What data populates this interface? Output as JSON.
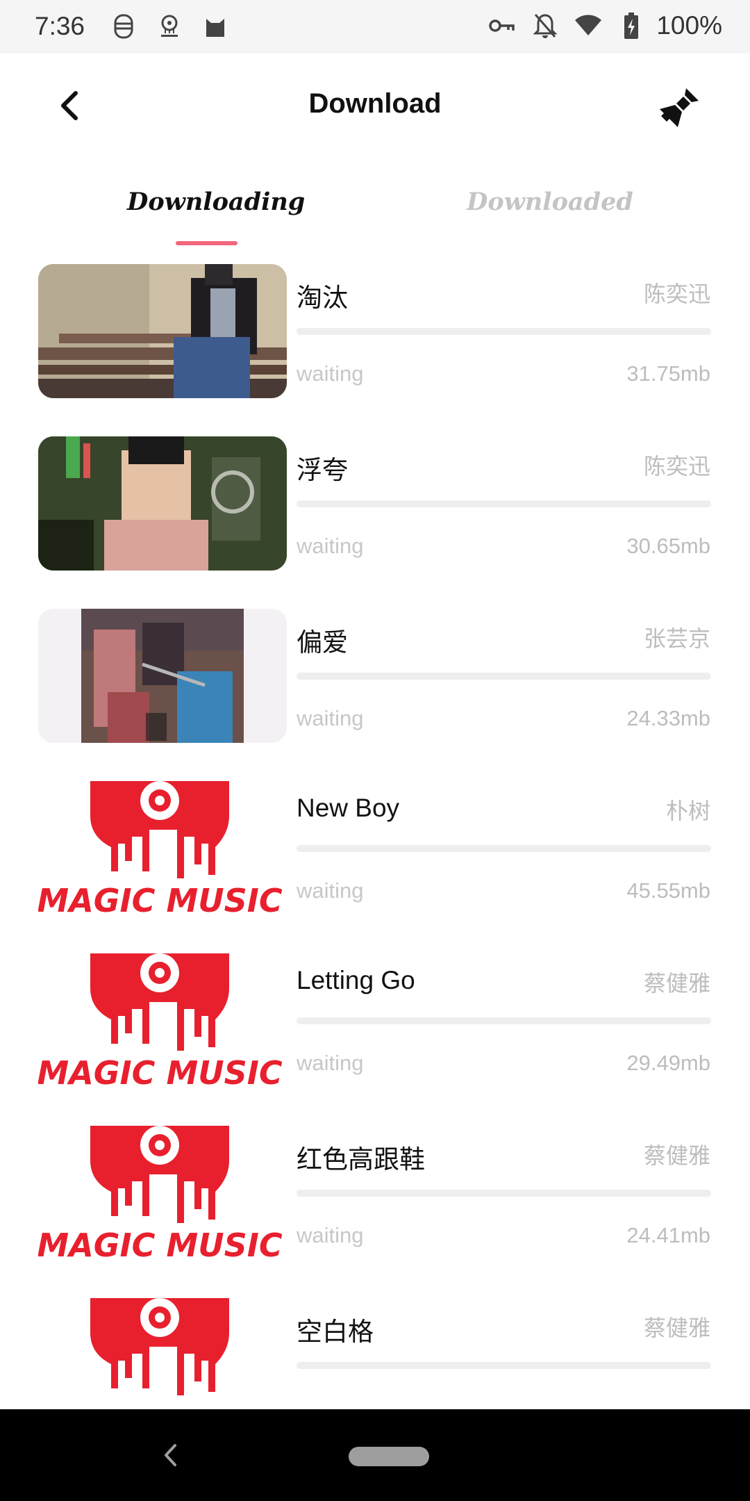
{
  "status_bar": {
    "time": "7:36",
    "battery": "100%",
    "left_icons": [
      "face-mask-icon",
      "magic-music-notification-icon",
      "cat-icon"
    ],
    "right_icons": [
      "vpn-key-icon",
      "notifications-off-icon",
      "wifi-icon",
      "battery-charging-icon"
    ]
  },
  "header": {
    "title": "Download",
    "back_icon": "arrow-back-icon",
    "clear_icon": "broom-clear-icon"
  },
  "tabs": [
    {
      "label": "Downloading",
      "active": true
    },
    {
      "label": "Downloaded",
      "active": false
    }
  ],
  "colors": {
    "accent": "#f0677c",
    "brand_red": "#e8202e",
    "muted_text": "#bdbdbd",
    "progress_track": "#eeeeee"
  },
  "downloads": [
    {
      "title": "淘汰",
      "artist": "陈奕迅",
      "status": "waiting",
      "size": "31.75mb",
      "progress": 0,
      "cover": "photo"
    },
    {
      "title": "浮夸",
      "artist": "陈奕迅",
      "status": "waiting",
      "size": "30.65mb",
      "progress": 0,
      "cover": "photo"
    },
    {
      "title": "偏爱",
      "artist": "张芸京",
      "status": "waiting",
      "size": "24.33mb",
      "progress": 0,
      "cover": "poster"
    },
    {
      "title": "New Boy",
      "artist": "朴树",
      "status": "waiting",
      "size": "45.55mb",
      "progress": 0,
      "cover": "magic-music-logo"
    },
    {
      "title": "Letting Go",
      "artist": "蔡健雅",
      "status": "waiting",
      "size": "29.49mb",
      "progress": 0,
      "cover": "magic-music-logo"
    },
    {
      "title": "红色高跟鞋",
      "artist": "蔡健雅",
      "status": "waiting",
      "size": "24.41mb",
      "progress": 0,
      "cover": "magic-music-logo"
    },
    {
      "title": "空白格",
      "artist": "蔡健雅",
      "status": "",
      "size": "",
      "progress": 0,
      "cover": "magic-music-logo"
    }
  ],
  "logo_text": "MAGIC MUSIC",
  "nav_bar": {
    "back_icon": "nav-back-icon",
    "home_icon": "nav-home-pill-icon"
  }
}
